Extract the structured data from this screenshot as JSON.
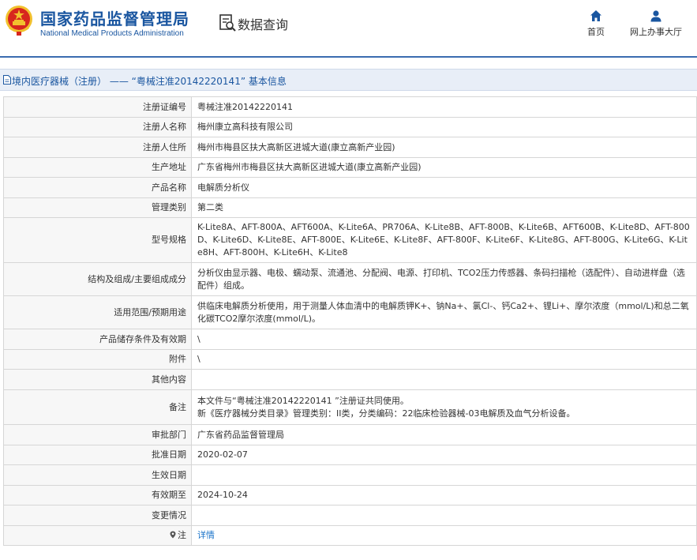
{
  "header": {
    "org_name_cn": "国家药品监督管理局",
    "org_name_en": "National Medical Products Administration",
    "query_label": "数据查询",
    "nav_home": "首页",
    "nav_online_hall": "网上办事大厅"
  },
  "title_bar": {
    "title": "境内医疗器械（注册） —— “粤械注准20142220141” 基本信息"
  },
  "record": {
    "rows": [
      {
        "label": "注册证编号",
        "value": "粤械注准20142220141"
      },
      {
        "label": "注册人名称",
        "value": "梅州康立高科技有限公司"
      },
      {
        "label": "注册人住所",
        "value": "梅州市梅县区扶大高新区进城大道(康立高新产业园)"
      },
      {
        "label": "生产地址",
        "value": "广东省梅州市梅县区扶大高新区进城大道(康立高新产业园)"
      },
      {
        "label": "产品名称",
        "value": "电解质分析仪"
      },
      {
        "label": "管理类别",
        "value": "第二类"
      },
      {
        "label": "型号规格",
        "value": "K-Lite8A、AFT-800A、AFT600A、K-Lite6A、PR706A、K-Lite8B、AFT-800B、K-Lite6B、AFT600B、K-Lite8D、AFT-800D、K-Lite6D、K-Lite8E、AFT-800E、K-Lite6E、K-Lite8F、AFT-800F、K-Lite6F、K-Lite8G、AFT-800G、K-Lite6G、K-Lite8H、AFT-800H、K-Lite6H、K-Lite8"
      },
      {
        "label": "结构及组成/主要组成成分",
        "value": "分析仪由显示器、电极、蠕动泵、流通池、分配阀、电源、打印机、TCO2压力传感器、条码扫描枪（选配件）、自动进样盘（选配件）组成。"
      },
      {
        "label": "适用范围/预期用途",
        "value": "供临床电解质分析使用，用于测量人体血清中的电解质钾K+、钠Na+、氯Cl-、钙Ca2+、锂Li+、摩尔浓度（mmol/L)和总二氧化碳TCO2摩尔浓度(mmol/L)。"
      },
      {
        "label": "产品储存条件及有效期",
        "value": "\\"
      },
      {
        "label": "附件",
        "value": "\\"
      },
      {
        "label": "其他内容",
        "value": ""
      },
      {
        "label": "备注",
        "value_line1": "本文件与“粤械注准20142220141 ”注册证共同使用。",
        "value_line2": "新《医疗器械分类目录》管理类别：II类，分类编码：22临床检验器械-03电解质及血气分析设备。"
      },
      {
        "label": "审批部门",
        "value": "广东省药品监督管理局"
      },
      {
        "label": "批准日期",
        "value": "2020-02-07"
      },
      {
        "label": "生效日期",
        "value": ""
      },
      {
        "label": "有效期至",
        "value": "2024-10-24"
      },
      {
        "label": "变更情况",
        "value": ""
      },
      {
        "label": "注",
        "value": "详情"
      }
    ]
  },
  "colors": {
    "brand_blue": "#1a56a0",
    "emblem_red": "#d7261e",
    "emblem_gold": "#f2c12e",
    "link_blue": "#1a73c9"
  },
  "icons": {
    "emblem": "national-emblem-icon",
    "query": "document-search-icon",
    "home": "home-icon",
    "user": "user-icon",
    "doc": "document-icon",
    "pin": "location-pin-icon"
  }
}
